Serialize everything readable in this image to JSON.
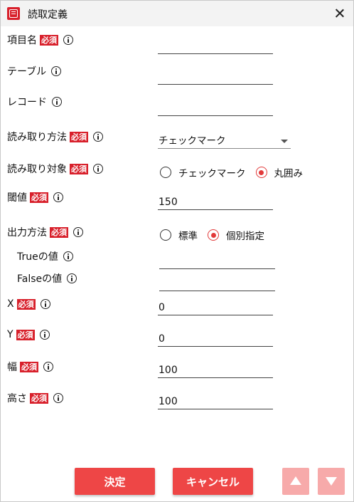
{
  "window": {
    "title": "読取定義"
  },
  "required_badge": "必須",
  "fields": {
    "item_name": {
      "label": "項目名",
      "value": ""
    },
    "table": {
      "label": "テーブル",
      "value": ""
    },
    "record": {
      "label": "レコード",
      "value": ""
    },
    "read_method": {
      "label": "読み取り方法",
      "selected": "チェックマーク"
    },
    "read_target": {
      "label": "読み取り対象",
      "options": [
        "チェックマーク",
        "丸囲み"
      ],
      "selected": "丸囲み"
    },
    "threshold": {
      "label": "閾値",
      "value": "150"
    },
    "output_method": {
      "label": "出力方法",
      "options": [
        "標準",
        "個別指定"
      ],
      "selected": "個別指定"
    },
    "true_value": {
      "label": "Trueの値",
      "value": ""
    },
    "false_value": {
      "label": "Falseの値",
      "value": ""
    },
    "x": {
      "label": "X",
      "value": "0"
    },
    "y": {
      "label": "Y",
      "value": "0"
    },
    "width": {
      "label": "幅",
      "value": "100"
    },
    "height": {
      "label": "高さ",
      "value": "100"
    }
  },
  "buttons": {
    "ok": "決定",
    "cancel": "キャンセル"
  },
  "icons": {
    "app": "app-logo-icon",
    "close": "close-icon",
    "info": "info-icon",
    "dropdown": "chevron-down-icon",
    "up": "arrow-up-icon",
    "down": "arrow-down-icon"
  },
  "colors": {
    "accent": "#ee4646",
    "badge": "#d8202b",
    "disabled_button": "#f7aaaa"
  }
}
